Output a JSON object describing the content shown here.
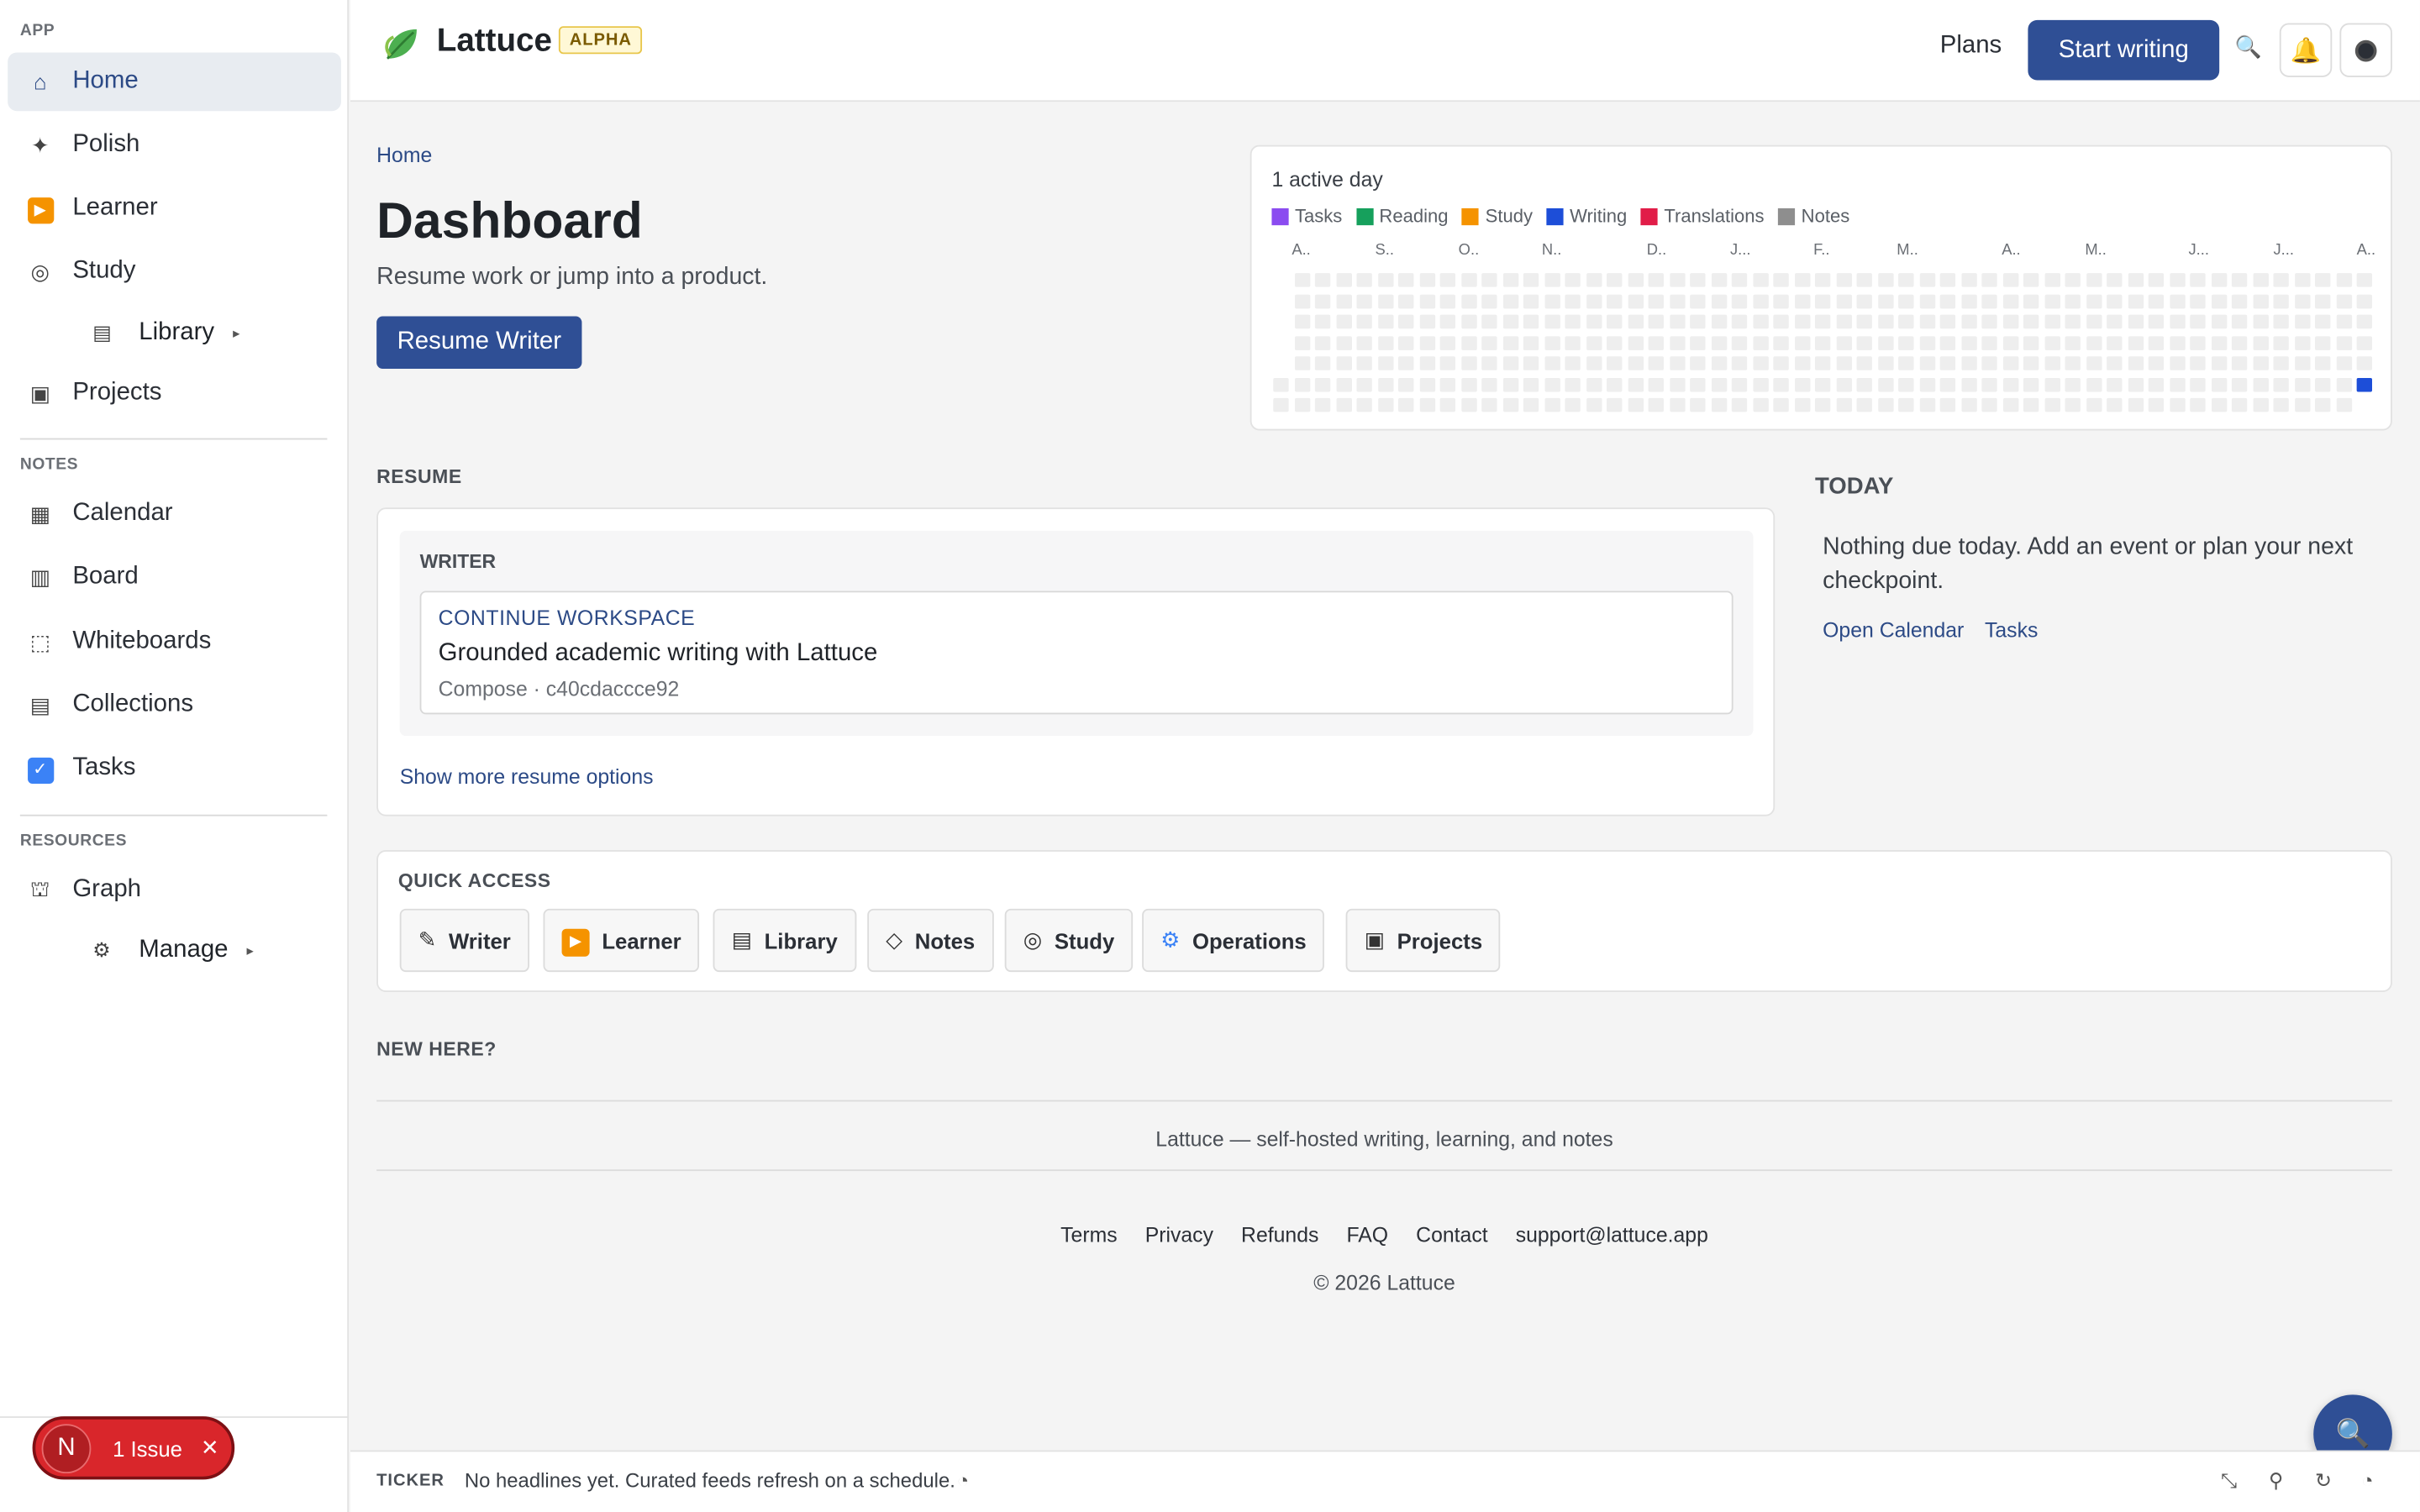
{
  "sidebar": {
    "sections": {
      "app": "APP",
      "notes": "NOTES",
      "resources": "RESOURCES"
    },
    "items": [
      {
        "label": "Home",
        "icon": "home-icon",
        "glyph": "⌂"
      },
      {
        "label": "Polish",
        "icon": "sparkle-icon",
        "glyph": "✦"
      },
      {
        "label": "Learner",
        "icon": "play-icon",
        "glyph": "▶"
      },
      {
        "label": "Study",
        "icon": "target-icon",
        "glyph": "◎"
      },
      {
        "label": "Library",
        "icon": "library-icon",
        "glyph": "▤"
      },
      {
        "label": "Projects",
        "icon": "projects-icon",
        "glyph": "▣"
      },
      {
        "label": "Calendar",
        "icon": "calendar-icon",
        "glyph": "▦"
      },
      {
        "label": "Board",
        "icon": "board-icon",
        "glyph": "▥"
      },
      {
        "label": "Whiteboards",
        "icon": "whiteboard-icon",
        "glyph": "⬚"
      },
      {
        "label": "Collections",
        "icon": "collections-icon",
        "glyph": "▤"
      },
      {
        "label": "Tasks",
        "icon": "checkbox-icon",
        "glyph": "☑"
      },
      {
        "label": "Graph",
        "icon": "graph-icon",
        "glyph": "⛫"
      },
      {
        "label": "Manage",
        "icon": "gear-icon",
        "glyph": "⚙"
      }
    ]
  },
  "header": {
    "brand": "Lattuce",
    "badge": "ALPHA",
    "plans": "Plans",
    "start_writing": "Start writing",
    "search_glyph": "🔍",
    "bell_glyph": "🔔"
  },
  "main": {
    "breadcrumb": "Home",
    "title": "Dashboard",
    "subtitle": "Resume work or jump into a product.",
    "resume_button": "Resume Writer"
  },
  "activity": {
    "title": "1 active day",
    "legend": [
      {
        "label": "Tasks",
        "color": "#8b4cf0"
      },
      {
        "label": "Reading",
        "color": "#16a05c"
      },
      {
        "label": "Study",
        "color": "#f59300"
      },
      {
        "label": "Writing",
        "color": "#1d4ed8"
      },
      {
        "label": "Translations",
        "color": "#e11d48"
      },
      {
        "label": "Notes",
        "color": "#8e8e8e"
      }
    ],
    "months": [
      "A..",
      "S..",
      "O..",
      "N..",
      "D..",
      "J...",
      "F..",
      "M..",
      "A..",
      "M..",
      "J...",
      "J...",
      "A.."
    ],
    "active_color": "#1d4ed8"
  },
  "resume": {
    "section": "RESUME",
    "group": "WRITER",
    "kicker": "CONTINUE WORKSPACE",
    "title": "Grounded academic writing with Lattuce",
    "meta": "Compose · c40cdaccce92",
    "show_more": "Show more resume options"
  },
  "today": {
    "title": "TODAY",
    "text": "Nothing due today. Add an event or plan your next checkpoint.",
    "link_calendar": "Open Calendar",
    "link_tasks": "Tasks"
  },
  "quick_access": {
    "label": "QUICK ACCESS",
    "items": [
      {
        "label": "Writer",
        "icon": "pencil-icon",
        "glyph": "✎"
      },
      {
        "label": "Learner",
        "icon": "play-icon",
        "glyph": "▶"
      },
      {
        "label": "Library",
        "icon": "library-icon",
        "glyph": "▤"
      },
      {
        "label": "Notes",
        "icon": "diamond-icon",
        "glyph": "◇"
      },
      {
        "label": "Study",
        "icon": "target-icon",
        "glyph": "◎"
      },
      {
        "label": "Operations",
        "icon": "gear-icon",
        "glyph": "⚙"
      },
      {
        "label": "Projects",
        "icon": "projects-icon",
        "glyph": "▣"
      }
    ]
  },
  "new_here": "NEW HERE?",
  "footer": {
    "tagline": "Lattuce — self-hosted writing, learning, and notes",
    "links": [
      "Terms",
      "Privacy",
      "Refunds",
      "FAQ",
      "Contact",
      "support@lattuce.app"
    ],
    "copyright": "© 2026 Lattuce"
  },
  "ticker": {
    "label": "TICKER",
    "text": "No headlines yet. Curated feeds refresh on a schedule."
  },
  "issue": {
    "avatar": "N",
    "label": "1 Issue"
  }
}
